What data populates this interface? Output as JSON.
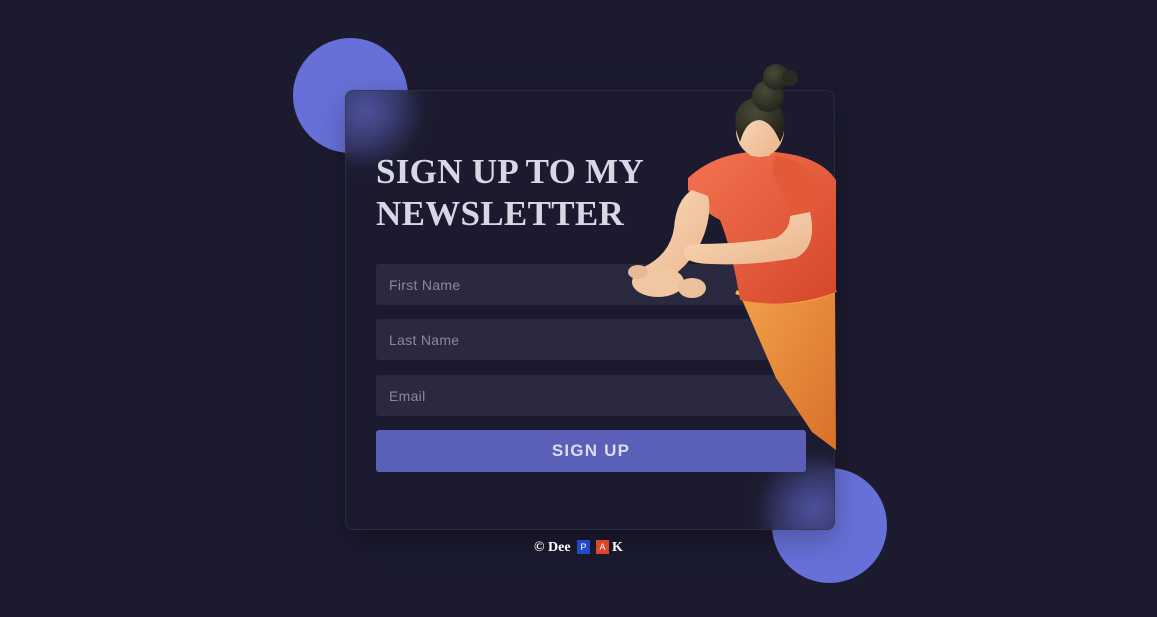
{
  "colors": {
    "background": "#1b1a2f",
    "accent": "#6770d8",
    "button": "#5a5fb8",
    "field": "#2a2940"
  },
  "form": {
    "title_line1": "SIGN UP TO MY",
    "title_line2": "NEWSLETTER",
    "first_name_placeholder": "First Name",
    "last_name_placeholder": "Last Name",
    "email_placeholder": "Email",
    "submit_label": "SIGN UP"
  },
  "footer": {
    "copyright": "© Dee",
    "tile_p": "P",
    "tile_a": "A",
    "end": "K"
  },
  "illustration": {
    "icon": "person-3d-illustration-icon"
  }
}
